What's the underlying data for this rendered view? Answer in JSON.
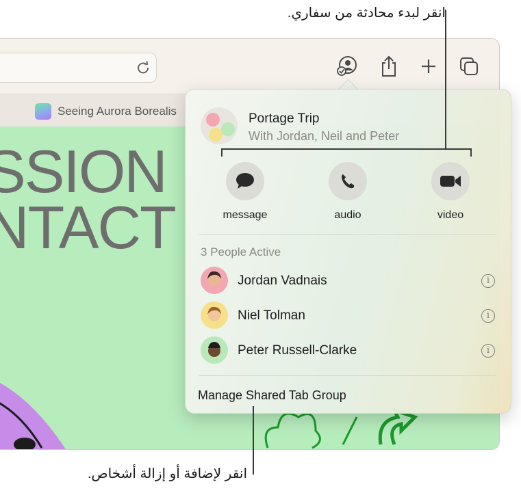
{
  "callouts": {
    "top": "انقر لبدء محادثة من سفاري.",
    "bottom": "انقر لإضافة أو إزالة أشخاص."
  },
  "browser": {
    "tab_title": "Seeing Aurora Borealis",
    "page_headline_1": "SSION",
    "page_headline_2": "NTACT",
    "toolbar_icons": [
      "shared-tab-group-icon",
      "share-icon",
      "new-tab-plus-icon",
      "tab-overview-icon"
    ]
  },
  "popover": {
    "title": "Portage Trip",
    "subtitle": "With Jordan, Neil and Peter",
    "actions": [
      {
        "label": "message",
        "icon": "message-bubble-icon"
      },
      {
        "label": "audio",
        "icon": "phone-icon"
      },
      {
        "label": "video",
        "icon": "video-camera-icon"
      }
    ],
    "active_heading": "3 People Active",
    "people": [
      {
        "name": "Jordan Vadnais",
        "avatar_color": "#f3a7b0"
      },
      {
        "name": "Niel Tolman",
        "avatar_color": "#f7e08a"
      },
      {
        "name": "Peter Russell-Clarke",
        "avatar_color": "#b9e8b9"
      }
    ],
    "manage_label": "Manage Shared Tab Group"
  },
  "colors": {
    "page_background": "#b7ecbd",
    "accent_green": "#1a9a2a"
  }
}
